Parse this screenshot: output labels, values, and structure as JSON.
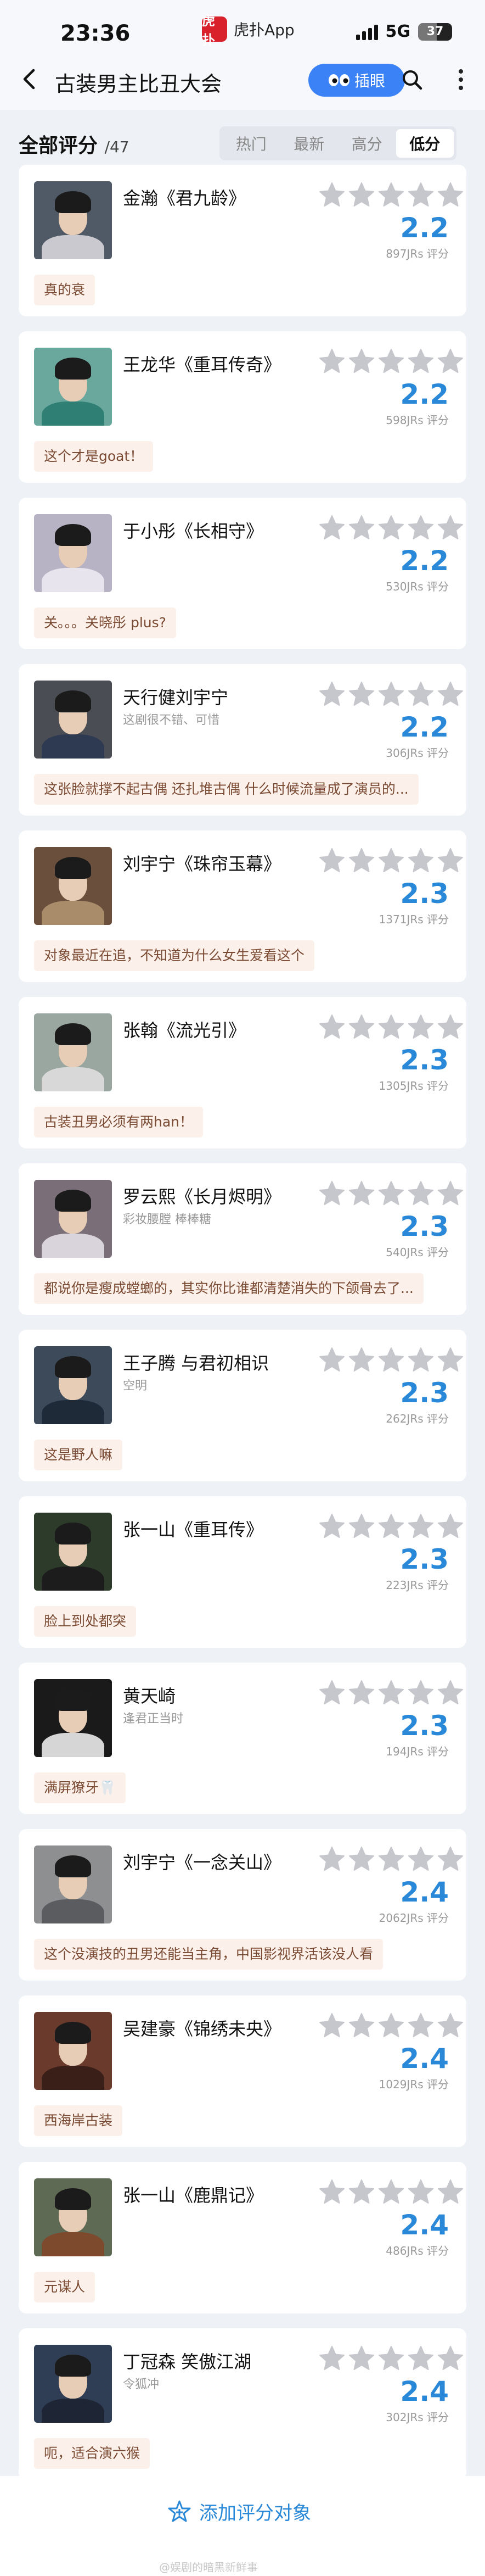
{
  "status_bar": {
    "time": "23:36",
    "app_logo_text": "虎扑",
    "app_name": "虎扑App",
    "network": "5G",
    "battery": "37"
  },
  "header": {
    "title": "古装男主比丑大会",
    "follow_button": "插眼"
  },
  "section": {
    "title": "全部评分",
    "count": "/47",
    "sort_tabs": [
      "热门",
      "最新",
      "高分",
      "低分"
    ],
    "active_sort": "低分"
  },
  "colors": {
    "accent": "#2a88d8",
    "comment_bg": "#fbf0ea",
    "star_empty": "#c5c7cc"
  },
  "cards": [
    {
      "name": "金瀚《君九龄》",
      "subtitle": "",
      "score": "2.2",
      "ratings": "897JRs 评分",
      "comment": "真的衰",
      "avatar_bg": "#4f5a66",
      "robe": "#c9c9cf"
    },
    {
      "name": "王龙华《重耳传奇》",
      "subtitle": "",
      "score": "2.2",
      "ratings": "598JRs 评分",
      "comment": "这个才是goat！",
      "avatar_bg": "#6aa79d",
      "robe": "#2f7f74"
    },
    {
      "name": "于小彤《长相守》",
      "subtitle": "",
      "score": "2.2",
      "ratings": "530JRs 评分",
      "comment": "关。。。关晓彤 plus?",
      "avatar_bg": "#b7b2c4",
      "robe": "#e8e4ee"
    },
    {
      "name": "天行健刘宇宁",
      "subtitle": "这剧很不错、可惜",
      "score": "2.2",
      "ratings": "306JRs 评分",
      "comment": "这张脸就撑不起古偶 还扎堆古偶 什么时候流量成了演员的...",
      "avatar_bg": "#4a4e54",
      "robe": "#2e3a52"
    },
    {
      "name": "刘宇宁《珠帘玉幕》",
      "subtitle": "",
      "score": "2.3",
      "ratings": "1371JRs 评分",
      "comment": "对象最近在追，不知道为什么女生爱看这个",
      "avatar_bg": "#6b4f3d",
      "robe": "#a98d6b"
    },
    {
      "name": "张翰《流光引》",
      "subtitle": "",
      "score": "2.3",
      "ratings": "1305JRs 评分",
      "comment": "古装丑男必须有两han！",
      "avatar_bg": "#9aa6a0",
      "robe": "#d8d8d8"
    },
    {
      "name": "罗云熙《长月烬明》",
      "subtitle": "彩妆腰膛 棒棒糖",
      "score": "2.3",
      "ratings": "540JRs 评分",
      "comment": "都说你是瘦成螳螂的，其实你比谁都清楚消失的下颌骨去了...",
      "avatar_bg": "#7a6f78",
      "robe": "#d9d3dc"
    },
    {
      "name": "王子腾 与君初相识",
      "subtitle": "空明",
      "score": "2.3",
      "ratings": "262JRs 评分",
      "comment": "这是野人嘛",
      "avatar_bg": "#3c4a5a",
      "robe": "#1f2a38"
    },
    {
      "name": "张一山《重耳传》",
      "subtitle": "",
      "score": "2.3",
      "ratings": "223JRs 评分",
      "comment": "脸上到处都突",
      "avatar_bg": "#2d3b2a",
      "robe": "#1c1c1c"
    },
    {
      "name": "黄天崎",
      "subtitle": "逢君正当时",
      "score": "2.3",
      "ratings": "194JRs 评分",
      "comment": "满屏獠牙🦷",
      "avatar_bg": "#1a1a1a",
      "robe": "#d6d6d6"
    },
    {
      "name": "刘宇宁《一念关山》",
      "subtitle": "",
      "score": "2.4",
      "ratings": "2062JRs 评分",
      "comment": "这个没演技的丑男还能当主角，中国影视界活该没人看",
      "avatar_bg": "#8d8f91",
      "robe": "#5a5c60"
    },
    {
      "name": "吴建豪《锦绣未央》",
      "subtitle": "",
      "score": "2.4",
      "ratings": "1029JRs 评分",
      "comment": "西海岸古装",
      "avatar_bg": "#6a3a2c",
      "robe": "#3a1f18"
    },
    {
      "name": "张一山《鹿鼎记》",
      "subtitle": "",
      "score": "2.4",
      "ratings": "486JRs 评分",
      "comment": "元谋人",
      "avatar_bg": "#5e6a53",
      "robe": "#7d4a2e"
    },
    {
      "name": "丁冠森 笑傲江湖",
      "subtitle": "令狐冲",
      "score": "2.4",
      "ratings": "302JRs 评分",
      "comment": "呃，适合演六猴",
      "avatar_bg": "#2f3e55",
      "robe": "#1e2636"
    }
  ],
  "bottom": {
    "add_label": "添加评分对象",
    "watermark": "@娱剧的暗黑新鲜事"
  }
}
